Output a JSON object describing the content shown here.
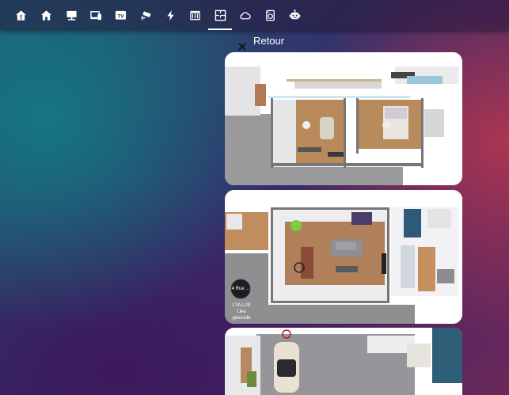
{
  "nav": {
    "icons": [
      "home-alert-icon",
      "home-icon",
      "monitor-icon",
      "devices-icon",
      "tv-icon",
      "cctv-icon",
      "lightning-icon",
      "radiator-icon",
      "floor-plan-icon",
      "cloud-icon",
      "washing-machine-icon",
      "robot-icon"
    ],
    "tv_text": "TV",
    "active_index": 8
  },
  "panel": {
    "back_label": "Retour",
    "close_icon": "close-icon"
  },
  "cards": [
    {
      "name": "floor-plan-1"
    },
    {
      "name": "floor-plan-2",
      "pin_label": "4 Rue ...",
      "pin_caption_line1": "LYA.L29",
      "pin_caption_line2": "Lieu",
      "pin_caption_line3": "géocodé"
    },
    {
      "name": "floor-plan-3"
    }
  ]
}
